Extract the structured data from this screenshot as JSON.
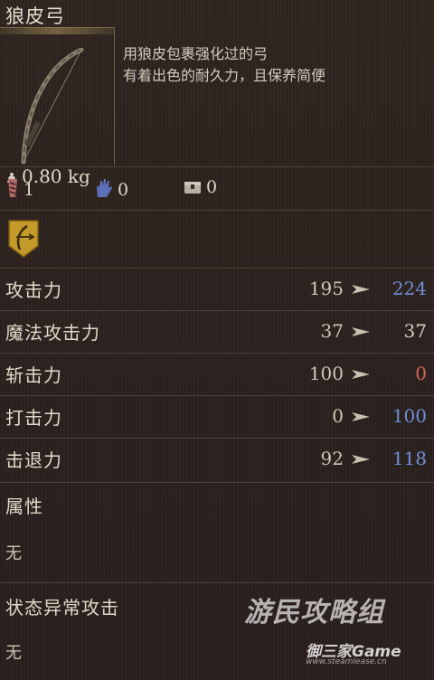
{
  "item": {
    "name": "狼皮弓",
    "weight": "0.80 kg",
    "description_line1": "用狼皮包裹强化过的弓",
    "description_line2": "有着出色的耐久力，且保养简便"
  },
  "requirements": [
    {
      "icon": "strength-icon",
      "value": "1",
      "color": "#c07070"
    },
    {
      "icon": "magic-hand-icon",
      "value": "0",
      "color": "#6a7fc8"
    },
    {
      "icon": "chest-icon",
      "value": "0",
      "color": "#b8b0a6"
    }
  ],
  "affinity_icon": "bow-affinity-emblem-icon",
  "stats": [
    {
      "label": "攻击力",
      "current": "195",
      "new": "224",
      "new_color": "#6f8ed8"
    },
    {
      "label": "魔法攻击力",
      "current": "37",
      "new": "37",
      "new_color": "#d9cfc0"
    },
    {
      "label": "斩击力",
      "current": "100",
      "new": "0",
      "new_color": "#d0655a"
    },
    {
      "label": "打击力",
      "current": "0",
      "new": "100",
      "new_color": "#6f8ed8"
    },
    {
      "label": "击退力",
      "current": "92",
      "new": "118",
      "new_color": "#6f8ed8"
    }
  ],
  "attribute": {
    "label": "属性",
    "value": "无"
  },
  "status_attack": {
    "label": "状态异常攻击",
    "value": "无"
  },
  "watermark": {
    "main": "游民攻略组",
    "sub": "御三家Game",
    "url": "www.steamlease.cn"
  }
}
